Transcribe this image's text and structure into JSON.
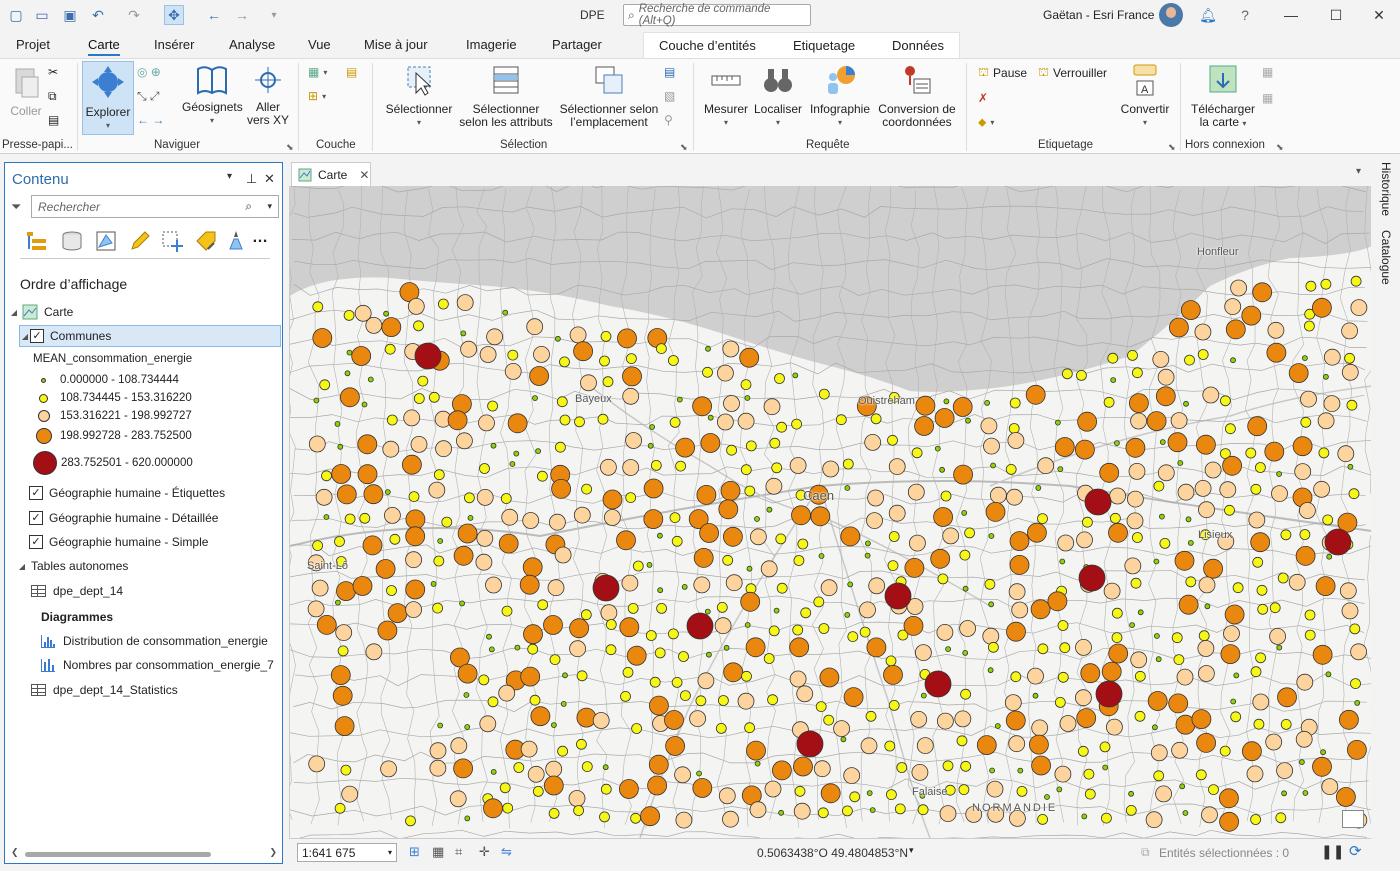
{
  "app": {
    "title": "DPE",
    "search_placeholder": "Recherche de commande (Alt+Q)",
    "user": "Gaëtan - Esri France"
  },
  "ribbon": {
    "tabs": [
      "Projet",
      "Carte",
      "Insérer",
      "Analyse",
      "Vue",
      "Mise à jour",
      "Imagerie",
      "Partager"
    ],
    "active_tab": "Carte",
    "context_tabs": [
      "Couche d’entités",
      "Etiquetage",
      "Données"
    ],
    "groups": {
      "clipboard": {
        "label": "Presse-papi...",
        "paste": "Coller"
      },
      "navigate": {
        "label": "Naviguer",
        "explore": "Explorer",
        "bookmarks": "Géosignets",
        "goto_xy_1": "Aller",
        "goto_xy_2": "vers XY"
      },
      "layer": {
        "label": "Couche"
      },
      "selection": {
        "label": "Sélection",
        "select": "Sélectionner",
        "by_attr_1": "Sélectionner",
        "by_attr_2": "selon les attributs",
        "by_loc_1": "Sélectionner selon",
        "by_loc_2": "l’emplacement"
      },
      "inquiry": {
        "label": "Requête",
        "measure": "Mesurer",
        "locate": "Localiser",
        "infographic": "Infographie",
        "convert_1": "Conversion de",
        "convert_2": "coordonnées"
      },
      "labeling": {
        "label": "Etiquetage",
        "pause": "Pause",
        "lock": "Verrouiller",
        "convert": "Convertir"
      },
      "offline": {
        "label": "Hors connexion",
        "download_1": "Télécharger",
        "download_2": "la carte"
      }
    }
  },
  "contents": {
    "title": "Contenu",
    "search_placeholder": "Rechercher",
    "draw_order": "Ordre d’affichage",
    "map_name": "Carte",
    "layer": "Communes",
    "field": "MEAN_consommation_energie",
    "classes": [
      {
        "label": "0.000000 - 108.734444",
        "color": "#8fd400"
      },
      {
        "label": "108.734445 - 153.316220",
        "color": "#f7f716"
      },
      {
        "label": "153.316221 - 198.992727",
        "color": "#fdd49e"
      },
      {
        "label": "198.992728 - 283.752500",
        "color": "#e9870f"
      },
      {
        "label": "283.752501 - 620.000000",
        "color": "#a30f15"
      }
    ],
    "basemap_layers": [
      "Géographie humaine - Étiquettes",
      "Géographie humaine - Détaillée",
      "Géographie humaine - Simple"
    ],
    "standalone_tables": "Tables autonomes",
    "table_1": "dpe_dept_14",
    "charts_heading": "Diagrammes",
    "charts": [
      "Distribution de consommation_energie",
      "Nombres par consommation_energie_7"
    ],
    "table_2": "dpe_dept_14_Statistics"
  },
  "map": {
    "tab": "Carte",
    "places": [
      "Honfleur",
      "Bayeux",
      "Ouistreham",
      "Caen",
      "Lisieux",
      "Saint-Lô",
      "Falaise",
      "NORMANDIE"
    ],
    "scale": "1:641 675",
    "coordinates": "0.5063438°O 49.4804853°N",
    "selected": "Entités sélectionnées : 0"
  },
  "right_dock": [
    "Historique",
    "Catalogue"
  ]
}
